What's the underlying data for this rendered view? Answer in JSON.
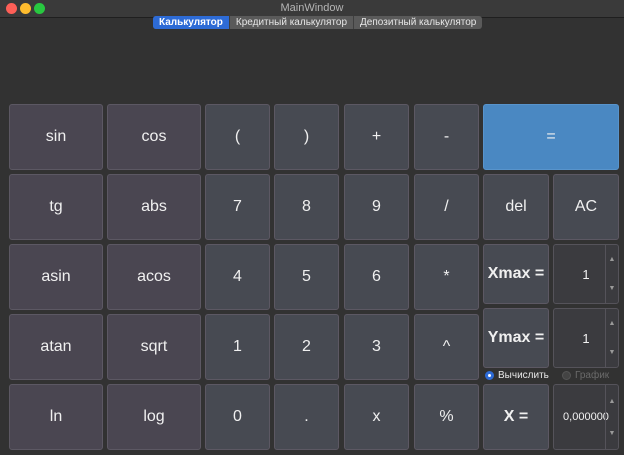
{
  "window": {
    "title": "MainWindow"
  },
  "tabs": [
    {
      "label": "Калькулятор",
      "active": true
    },
    {
      "label": "Кредитный калькулятор",
      "active": false
    },
    {
      "label": "Депозитный калькулятор",
      "active": false
    }
  ],
  "display": {
    "expression": ""
  },
  "keys": {
    "sin": "sin",
    "cos": "cos",
    "lparen": "(",
    "rparen": ")",
    "plus": "+",
    "minus": "-",
    "equals": "=",
    "tg": "tg",
    "abs": "abs",
    "seven": "7",
    "eight": "8",
    "nine": "9",
    "divide": "/",
    "del": "del",
    "ac": "AC",
    "asin": "asin",
    "acos": "acos",
    "four": "4",
    "five": "5",
    "six": "6",
    "multiply": "*",
    "atan": "atan",
    "sqrt": "sqrt",
    "one": "1",
    "two": "2",
    "three": "3",
    "power": "^",
    "ln": "ln",
    "log": "log",
    "zero": "0",
    "dot": ".",
    "x": "x",
    "mod": "%"
  },
  "graph_settings": {
    "xmax_label": "Xmax =",
    "xmax_value": "1",
    "ymax_label": "Ymax =",
    "ymax_value": "1",
    "x_label": "X =",
    "x_value": "0,000000"
  },
  "mode": {
    "calculate_label": "Вычислить",
    "calculate_selected": true,
    "graph_label": "График",
    "graph_enabled": false
  },
  "colors": {
    "accent": "#2d6bd6",
    "equals": "#4a88c2",
    "button": "#4a4651",
    "background": "#323232"
  }
}
